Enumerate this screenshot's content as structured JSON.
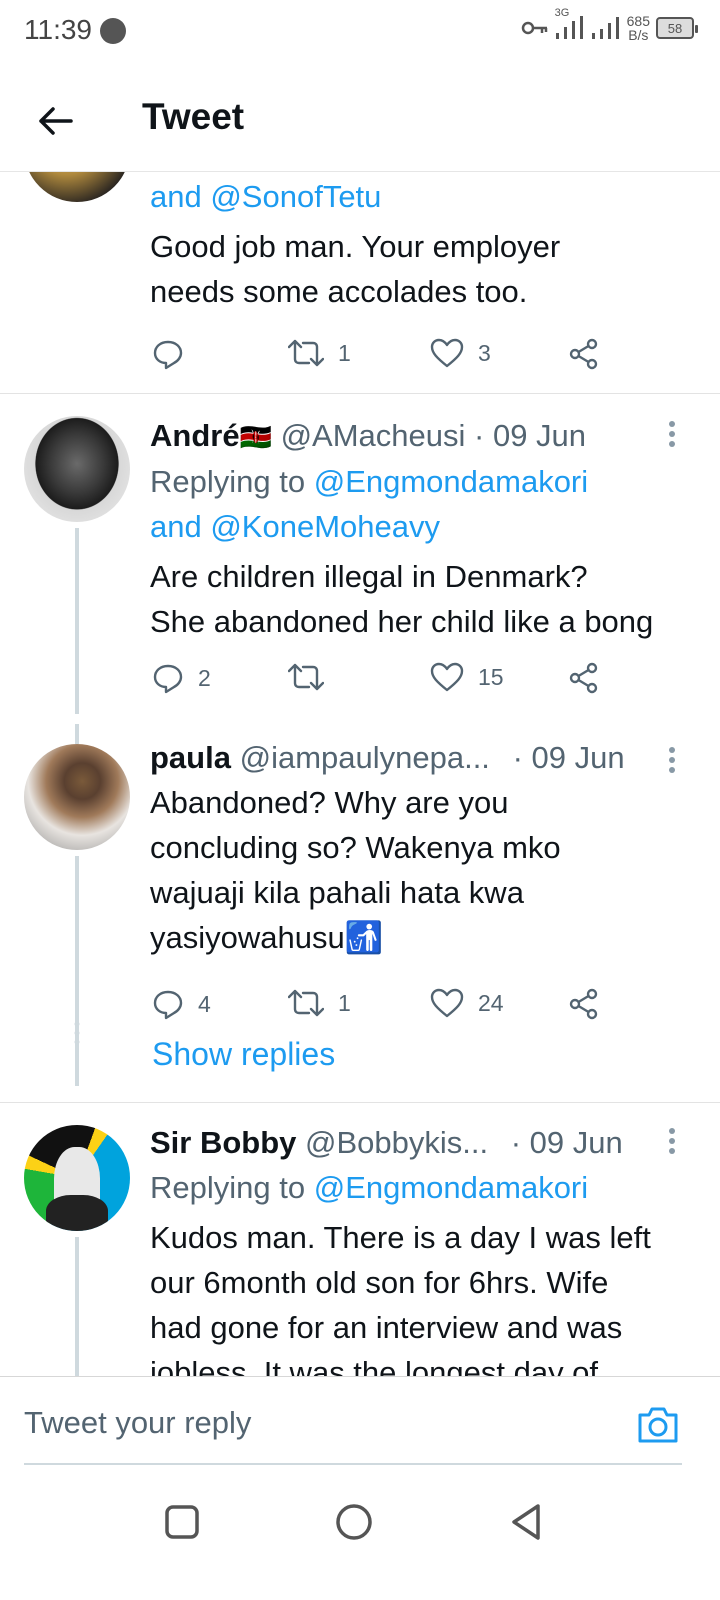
{
  "status_bar": {
    "time": "11:39",
    "network": "3G",
    "speed_value": "685",
    "speed_unit": "B/s",
    "battery": "58"
  },
  "header": {
    "title": "Tweet"
  },
  "tweets": [
    {
      "reply_links": "and @SonofTetu",
      "text_lines": [
        "Good job man. Your employer",
        "needs some accolades too."
      ],
      "replies": "",
      "retweets": "1",
      "likes": "3"
    },
    {
      "name": "André",
      "flag": "🇰🇪",
      "handle": "@AMacheusi",
      "date": "· 09 Jun",
      "replying_prefix": "Replying to ",
      "replying_to": "@Engmondamakori",
      "replying_more": "and @KoneMoheavy",
      "text_lines": [
        "Are children illegal in Denmark?",
        "She abandoned her child like a bong"
      ],
      "replies": "2",
      "retweets": "",
      "likes": "15"
    },
    {
      "name": "paula",
      "handle": "@iampaulynepa...",
      "date": "· 09 Jun",
      "text_lines": [
        "Abandoned? Why are you",
        "concluding so? Wakenya mko",
        "wajuaji kila pahali hata kwa",
        "yasiyowahusu🚮"
      ],
      "replies": "4",
      "retweets": "1",
      "likes": "24",
      "show_replies": "Show replies"
    },
    {
      "name": "Sir Bobby",
      "handle": "@Bobbykis...",
      "date": "· 09 Jun",
      "replying_prefix": "Replying to ",
      "replying_to": "@Engmondamakori",
      "text_lines": [
        "Kudos man. There is a day I was left",
        "our 6month old son for 6hrs. Wife",
        "had gone for an interview and was",
        "jobless. It was the longest day of"
      ]
    }
  ],
  "reply_bar": {
    "placeholder": "Tweet your reply"
  },
  "colors": {
    "link": "#1d9bf0",
    "secondary_text": "#536471",
    "primary_text": "#0f1419"
  }
}
